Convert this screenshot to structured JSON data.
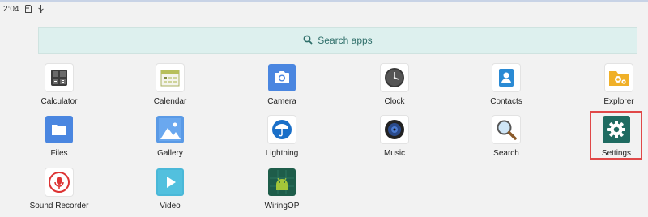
{
  "status_bar": {
    "time": "2:04"
  },
  "search": {
    "label": "Search apps",
    "icon": "search-icon"
  },
  "apps": [
    {
      "label": "Calculator",
      "icon": "calculator-icon"
    },
    {
      "label": "Calendar",
      "icon": "calendar-icon"
    },
    {
      "label": "Camera",
      "icon": "camera-icon"
    },
    {
      "label": "Clock",
      "icon": "clock-icon"
    },
    {
      "label": "Contacts",
      "icon": "contacts-icon"
    },
    {
      "label": "Explorer",
      "icon": "folder-gear-icon"
    },
    {
      "label": "Files",
      "icon": "files-icon"
    },
    {
      "label": "Gallery",
      "icon": "gallery-icon"
    },
    {
      "label": "Lightning",
      "icon": "lightning-icon"
    },
    {
      "label": "Music",
      "icon": "music-icon"
    },
    {
      "label": "Search",
      "icon": "magnifier-icon"
    },
    {
      "label": "Settings",
      "icon": "gear-icon"
    },
    {
      "label": "Sound Recorder",
      "icon": "microphone-icon"
    },
    {
      "label": "Video",
      "icon": "play-icon"
    },
    {
      "label": "WiringOP",
      "icon": "android-icon"
    }
  ],
  "highlight_color": "#e04848",
  "accent_color": "#2f6f6a"
}
